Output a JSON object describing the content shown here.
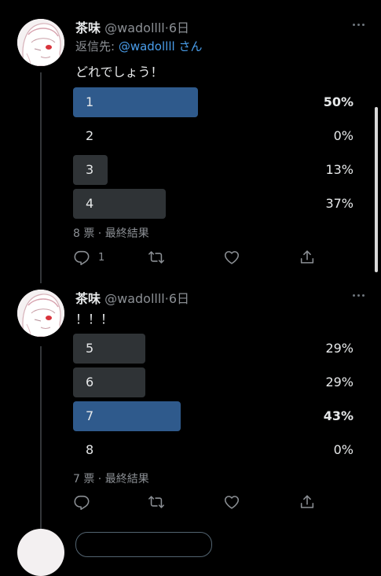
{
  "tweets": [
    {
      "name": "茶味",
      "handle": "@wadollll",
      "separator": "·",
      "time": "6日",
      "reply_prefix": "返信先: ",
      "reply_mention": "@wadollll",
      "reply_suffix": " さん",
      "text": "どれでしょう！",
      "poll": {
        "options": [
          {
            "label": "1",
            "percent": "50%",
            "fraction": 0.5,
            "winner": true
          },
          {
            "label": "2",
            "percent": "0%",
            "fraction": 0.0,
            "winner": false
          },
          {
            "label": "3",
            "percent": "13%",
            "fraction": 0.13,
            "winner": false
          },
          {
            "label": "4",
            "percent": "37%",
            "fraction": 0.37,
            "winner": false
          }
        ],
        "meta": "8 票 · 最終結果"
      },
      "actions": {
        "reply_count": "1",
        "retweet_count": "",
        "like_count": ""
      }
    },
    {
      "name": "茶味",
      "handle": "@wadollll",
      "separator": "·",
      "time": "6日",
      "text": "！！！",
      "poll": {
        "options": [
          {
            "label": "5",
            "percent": "29%",
            "fraction": 0.29,
            "winner": false
          },
          {
            "label": "6",
            "percent": "29%",
            "fraction": 0.29,
            "winner": false
          },
          {
            "label": "7",
            "percent": "43%",
            "fraction": 0.43,
            "winner": true
          },
          {
            "label": "8",
            "percent": "0%",
            "fraction": 0.0,
            "winner": false
          }
        ],
        "meta": "7 票 · 最終結果"
      },
      "actions": {
        "reply_count": "",
        "retweet_count": "",
        "like_count": ""
      }
    }
  ],
  "icons": {
    "more": "more-horizontal-icon",
    "reply": "reply-icon",
    "retweet": "retweet-icon",
    "like": "heart-icon",
    "share": "share-icon"
  },
  "colors": {
    "background": "#000000",
    "winner_bar": "#2f5a8c",
    "loser_bar": "#2f3336",
    "mention": "#4a9eeb",
    "muted": "#8b8f94"
  }
}
